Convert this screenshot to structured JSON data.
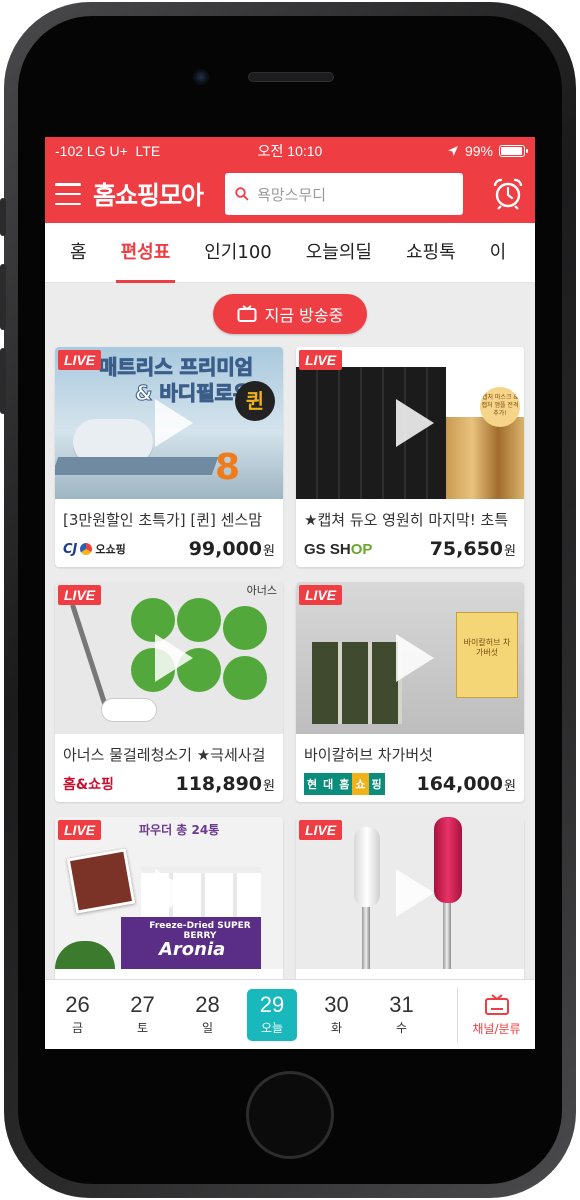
{
  "status_bar": {
    "carrier": "-102 LG U+  LTE",
    "time": "오전 10:10",
    "battery": "99%"
  },
  "header": {
    "app_title": "홈쇼핑모아",
    "search_placeholder": "욕망스무디"
  },
  "tabs": [
    {
      "label": "홈"
    },
    {
      "label": "편성표",
      "active": true
    },
    {
      "label": "인기100"
    },
    {
      "label": "오늘의딜"
    },
    {
      "label": "쇼핑톡"
    },
    {
      "label": "이"
    }
  ],
  "on_air_button": "지금 방송중",
  "live_badge": "LIVE",
  "products": [
    {
      "thumb_text_1": "매트리스 프리미엄",
      "thumb_text_2": "& 바디필로우",
      "thumb_badge": "퀸",
      "thumb_number": "8",
      "title": "[3만원할인 초특가] [퀸] 센스맘",
      "channel": "CJ 오쇼핑",
      "channel_cj": "CJ",
      "channel_rest": "오쇼핑",
      "price": "99,000",
      "unit": "원"
    },
    {
      "thumb_text_1": "캡처 마스크 & 캡처 앰플 전격추가!",
      "title": "★캡쳐 듀오 영원히 마지막! 초특",
      "channel": "GS SHOP",
      "channel_gs": "GS SH",
      "channel_op": "OP",
      "price": "75,650",
      "unit": "원"
    },
    {
      "thumb_text_1": "아너스",
      "title": "아너스 물걸레청소기 ★극세사걸",
      "channel": "홈&쇼핑",
      "price": "118,890",
      "unit": "원"
    },
    {
      "thumb_text_1": "바이칼허브 차가버섯",
      "title": "바이칼허브 차가버섯",
      "channel": "현대홈쇼핑",
      "channel_parts": [
        "현",
        "대",
        "홈",
        "쇼",
        "핑"
      ],
      "price": "164,000",
      "unit": "원"
    },
    {
      "thumb_text_1": "파우더 총 24통",
      "thumb_text_2": "Freeze-Dried SUPER BERRY",
      "thumb_text_3": "Aronia",
      "title": "",
      "channel": "",
      "price": "",
      "unit": ""
    },
    {
      "title": "",
      "channel": "",
      "price": "",
      "unit": ""
    }
  ],
  "date_bar": {
    "days": [
      {
        "num": "26",
        "weekday": "금"
      },
      {
        "num": "27",
        "weekday": "토"
      },
      {
        "num": "28",
        "weekday": "일"
      },
      {
        "num": "29",
        "weekday": "오늘",
        "today": true
      },
      {
        "num": "30",
        "weekday": "화"
      },
      {
        "num": "31",
        "weekday": "수"
      }
    ],
    "channel_label": "채널/분류"
  },
  "colors": {
    "brand_red": "#ef3e43",
    "today_teal": "#19b8bd"
  }
}
